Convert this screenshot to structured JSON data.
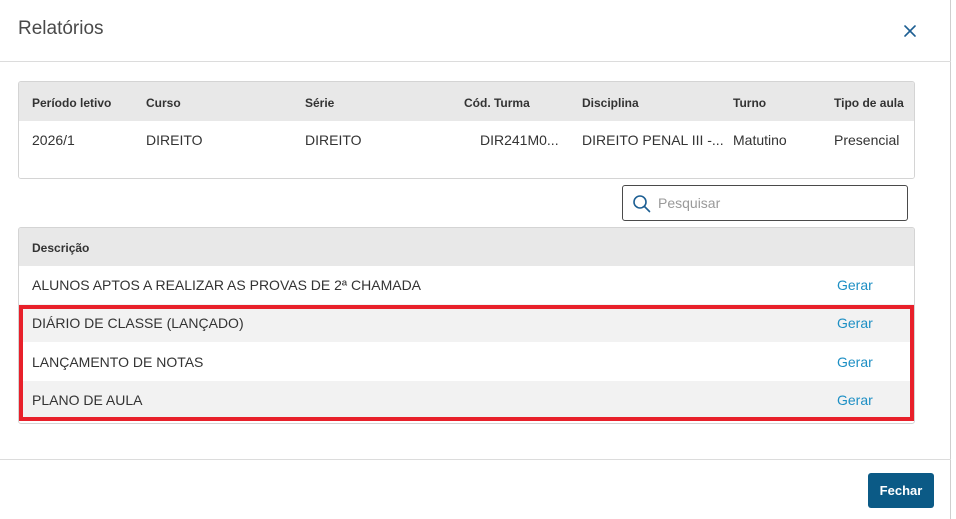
{
  "dialog": {
    "title": "Relatórios",
    "close_label": "Fechar"
  },
  "class_info": {
    "headers": [
      "Período letivo",
      "Curso",
      "Série",
      "Cód. Turma",
      "Disciplina",
      "Turno",
      "Tipo de aula"
    ],
    "values": [
      "2026/1",
      "DIREITO",
      "DIREITO",
      "DIR241M0...",
      "DIREITO PENAL III -...",
      "Matutino",
      "Presencial"
    ]
  },
  "search": {
    "placeholder": "Pesquisar",
    "value": ""
  },
  "reports": {
    "header": "Descrição",
    "action_label": "Gerar",
    "rows": [
      {
        "description": "ALUNOS APTOS A REALIZAR AS PROVAS DE 2ª CHAMADA"
      },
      {
        "description": "DIÁRIO DE CLASSE (LANÇADO)"
      },
      {
        "description": "LANÇAMENTO DE NOTAS"
      },
      {
        "description": "PLANO DE AULA"
      }
    ]
  },
  "colors": {
    "accent": "#0b5a86",
    "link": "#1d8fc4",
    "highlight": "#e8202a"
  }
}
